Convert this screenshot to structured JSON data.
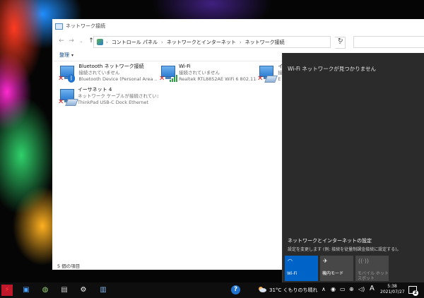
{
  "explorer": {
    "title": "ネットワーク接続",
    "breadcrumb": [
      "コントロール パネル",
      "ネットワークとインターネット",
      "ネットワーク接続"
    ],
    "organize_label": "整理",
    "adapters": [
      {
        "name": "Bluetooth ネットワーク接続",
        "status": "接続されていません",
        "device": "Bluetooth Device (Personal Area ..."
      },
      {
        "name": "Wi-Fi",
        "status": "接続されていません",
        "device": "Realtek RTL8852AE WiFi 6 802.11a..."
      },
      {
        "name": "イ",
        "status": "接",
        "device": "E"
      },
      {
        "name": "イーサネット 4",
        "status": "ネットワーク ケーブルが接続されていま...",
        "device": "ThinkPad USB-C Dock Ethernet"
      }
    ],
    "item_count": "5 個の項目"
  },
  "flyout": {
    "message": "Wi-Fi ネットワークが見つかりません",
    "settings_link": "ネットワークとインターネットの設定",
    "settings_sub": "設定を変更します (例: 接続を従量制課金接続に設定する)。",
    "tiles": [
      {
        "label": "Wi-Fi",
        "icon": "wifi-icon",
        "state": "on"
      },
      {
        "label": "機内モード",
        "icon": "airplane-icon",
        "state": "off"
      },
      {
        "label": "モバイル ホットスポット",
        "icon": "hotspot-icon",
        "state": "disabled"
      }
    ]
  },
  "taskbar": {
    "weather": "31°C くもりのち晴れ",
    "input_indicator": "A",
    "time": "5:38",
    "date": "2021/07/27",
    "notification_count": "2"
  }
}
